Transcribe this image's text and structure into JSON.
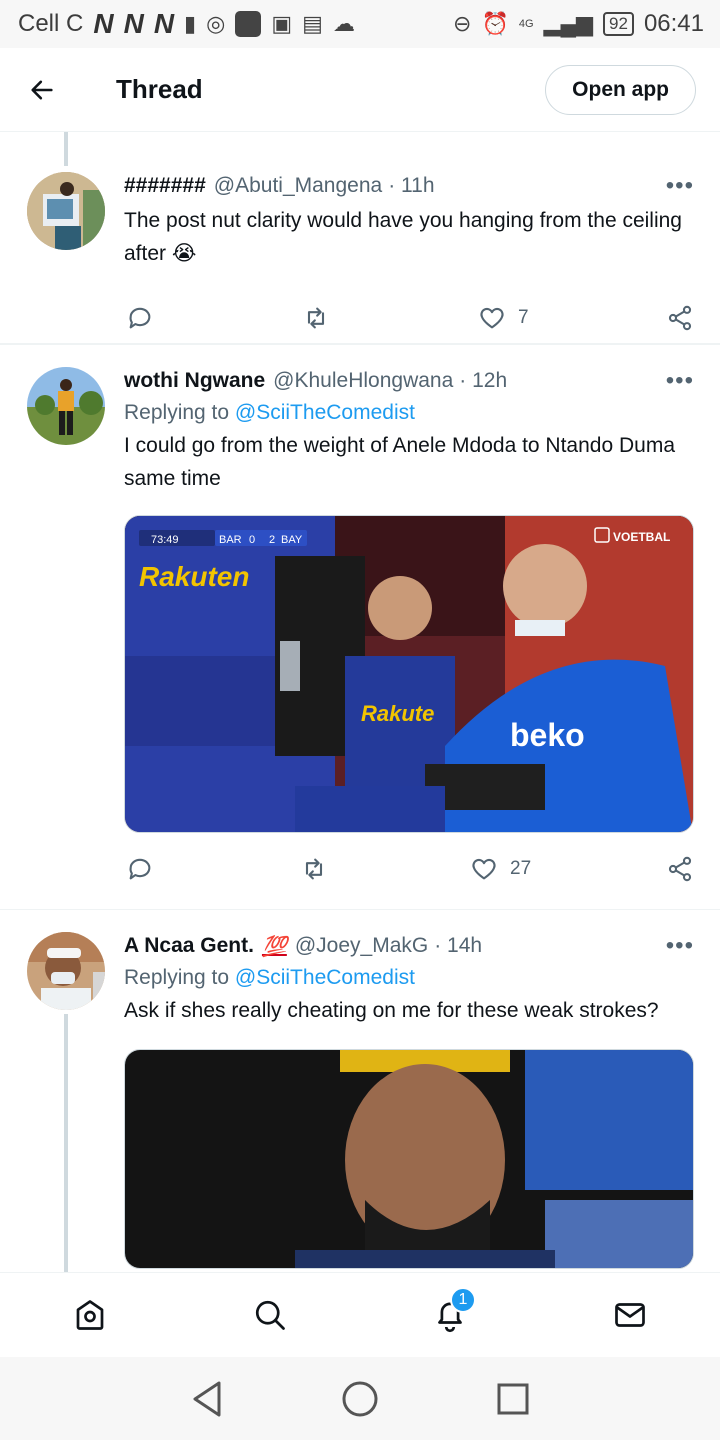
{
  "status_bar": {
    "carrier": "Cell C",
    "network_letters": [
      "N",
      "N",
      "N"
    ],
    "network_type": "4G",
    "battery": "92",
    "time": "06:41",
    "icons": [
      "sd-card-icon",
      "camera-icon",
      "app-icon",
      "gallery-icon",
      "calendar-icon",
      "cloud-icon",
      "dnd-icon",
      "alarm-icon",
      "signal-icon"
    ]
  },
  "header": {
    "title": "Thread",
    "open_app_label": "Open app"
  },
  "tweets": [
    {
      "name": "#######",
      "handle": "@Abuti_Mangena",
      "time": "· 11h",
      "text": "The post nut clarity would have you hanging from the ceiling after 😭",
      "likes": "7"
    },
    {
      "name": "wothi Ngwane",
      "handle": "@KhuleHlongwana",
      "time": "· 12h",
      "replying_prefix": "Replying to",
      "replying_to": "@SciiTheComedist",
      "text": "I could go from the weight of Anele Mdoda to Ntando Duma same time",
      "likes": "27",
      "media": {
        "scoreboard_time": "73:49",
        "team_home": "BAR",
        "score_home": "0",
        "score_away": "2",
        "team_away": "BAY",
        "broadcaster": "VOETBAL",
        "sponsor_left": "Rakuten",
        "sponsor_mid": "Rakute",
        "sponsor_right": "beko"
      }
    },
    {
      "name": "A Ncaa Gent.",
      "badge": "💯",
      "handle": "@Joey_MakG",
      "time": "· 14h",
      "replying_prefix": "Replying to",
      "replying_to": "@SciiTheComedist",
      "text": "Ask if shes really cheating on me for these weak strokes?"
    }
  ],
  "bottom_nav": {
    "notifications_badge": "1"
  },
  "colors": {
    "accent": "#1d9bf0",
    "text_primary": "#0f1419",
    "text_secondary": "#536471"
  }
}
